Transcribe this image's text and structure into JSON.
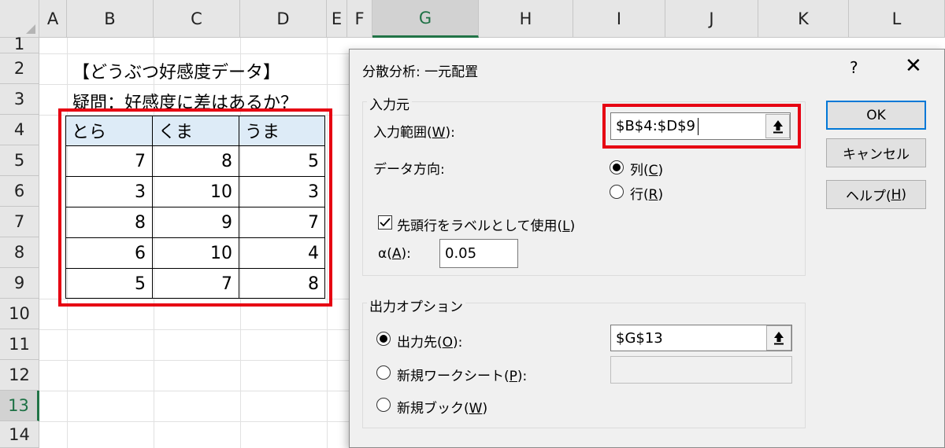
{
  "sheet": {
    "columns": [
      "A",
      "B",
      "C",
      "D",
      "E",
      "F",
      "G",
      "H",
      "I",
      "J",
      "K",
      "L"
    ],
    "rows": [
      "1",
      "2",
      "3",
      "4",
      "5",
      "6",
      "7",
      "8",
      "9",
      "10",
      "11",
      "12",
      "13",
      "14"
    ],
    "selected_column": "G",
    "selected_row": "13",
    "title": "【どうぶつ好感度データ】",
    "question": "疑問：好感度に差はあるか？",
    "table_headers": [
      "とら",
      "くま",
      "うま"
    ],
    "table_rows": [
      [
        "7",
        "8",
        "5"
      ],
      [
        "3",
        "10",
        "3"
      ],
      [
        "8",
        "9",
        "7"
      ],
      [
        "6",
        "10",
        "4"
      ],
      [
        "5",
        "7",
        "8"
      ]
    ]
  },
  "dialog": {
    "title": "分散分析: 一元配置",
    "help": "?",
    "close": "✕",
    "input_group": "入力元",
    "input_range_label": "入力範囲(",
    "input_range_key": "W",
    "input_range_suffix": "):",
    "input_range_value": "$B$4:$D$9",
    "direction_label": "データ方向:",
    "col_label": "列(",
    "col_key": "C",
    "row_label": "行(",
    "row_key": "R",
    "close_paren": ")",
    "labels_first_row": "先頭行をラベルとして使用(",
    "labels_key": "L",
    "alpha_label": "α(",
    "alpha_key": "A",
    "alpha_suffix": "):",
    "alpha_value": "0.05",
    "output_group": "出力オプション",
    "output_range_label": "出力先(",
    "output_range_key": "O",
    "output_range_suffix": "):",
    "output_range_value": "$G$13",
    "new_sheet_label": "新規ワークシート(",
    "new_sheet_key": "P",
    "new_sheet_suffix": "):",
    "new_book_label": "新規ブック(",
    "new_book_key": "W",
    "ok": "OK",
    "cancel": "キャンセル",
    "help_btn": "ヘルプ(",
    "help_key": "H"
  }
}
